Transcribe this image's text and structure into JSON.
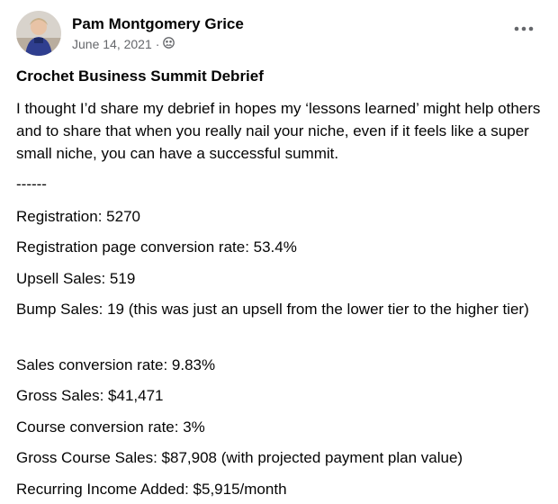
{
  "post": {
    "author": "Pam Montgomery Grice",
    "date": "June 14, 2021",
    "separator": "·",
    "audience_icon": "friends-audience-icon",
    "more_icon": "more-options-icon",
    "title": "Crochet Business Summit Debrief",
    "intro": "I thought I’d share my debrief in hopes my ‘lessons learned’ might help others and to share that when you really nail your niche, even if it feels like a super small niche, you can have a successful summit.",
    "divider": "------",
    "stats": [
      "Registration: 5270",
      "Registration page conversion rate: 53.4%",
      "Upsell Sales: 519",
      "Bump Sales: 19 (this was just an upsell from the lower tier to the higher tier)",
      "Sales conversion rate: 9.83%",
      "Gross Sales: $41,471",
      "Course conversion rate: 3%",
      "Gross Course Sales: $87,908 (with projected payment plan value)",
      "Recurring Income Added: $5,915/month"
    ]
  }
}
